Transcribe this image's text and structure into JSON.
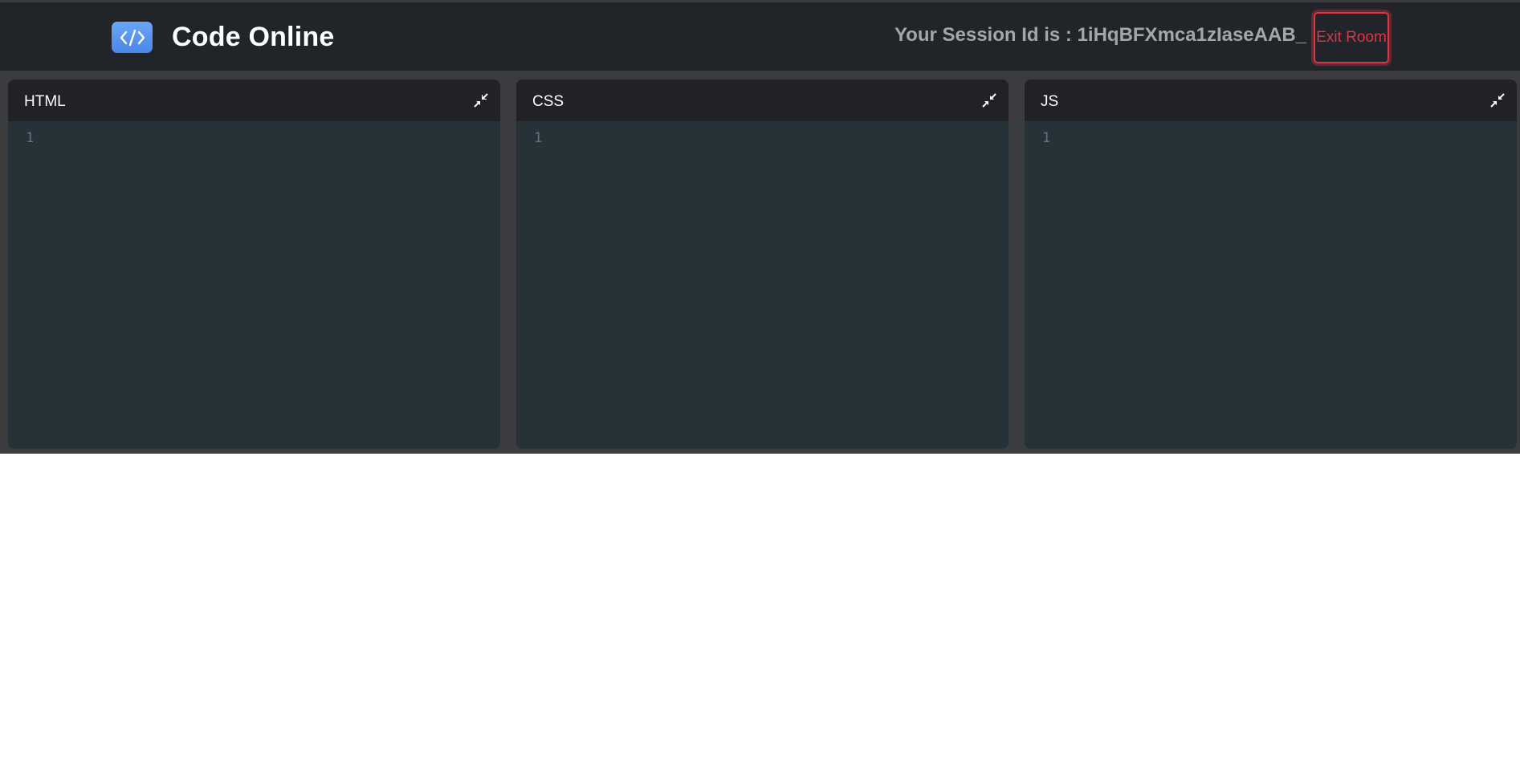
{
  "header": {
    "app_title": "Code Online",
    "logo_icon": "code-brackets-icon",
    "session_text": "Your Session Id is : 1iHqBFXmca1zIaseAAB_",
    "exit_button_label": "Exit Room"
  },
  "panels": [
    {
      "title": "HTML",
      "line_number": "1",
      "collapse_icon": "collapse-arrows-icon"
    },
    {
      "title": "CSS",
      "line_number": "1",
      "collapse_icon": "collapse-arrows-icon"
    },
    {
      "title": "JS",
      "line_number": "1",
      "collapse_icon": "collapse-arrows-icon"
    }
  ],
  "colors": {
    "navbar_bg": "#212429",
    "page_bg": "#3b3c40",
    "editor_bg": "#263238",
    "panel_header_bg": "#202226",
    "accent_blue": "#4a86e8",
    "danger": "#dc3545"
  }
}
